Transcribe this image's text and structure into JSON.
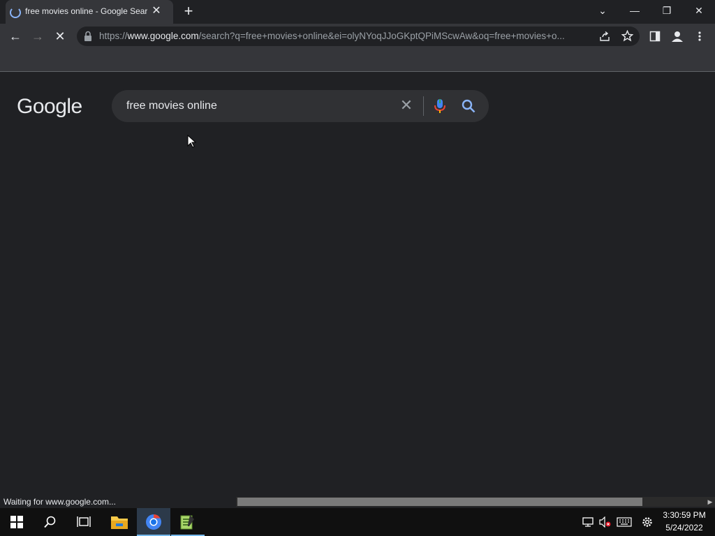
{
  "tab": {
    "title": "free movies online - Google Sear",
    "close": "✕"
  },
  "window": {
    "tablist": "⌄",
    "minimize": "—",
    "restore": "❐",
    "close": "✕"
  },
  "toolbar": {
    "back": "←",
    "forward": "→",
    "stop": "✕",
    "url_prefix": "https://",
    "url_host": "www.google.com",
    "url_rest": "/search?q=free+movies+online&ei=olyNYoqJJoGKptQPiMScwAw&oq=free+movies+o..."
  },
  "page": {
    "logo": "Google",
    "query": "free movies online",
    "clear": "✕"
  },
  "status": {
    "text": "Waiting for www.google.com..."
  },
  "taskbar": {
    "time": "3:30:59 PM",
    "date": "5/24/2022"
  },
  "colors": {
    "background": "#202124",
    "toolbar": "#35363a",
    "accent": "#8ab4f8"
  }
}
